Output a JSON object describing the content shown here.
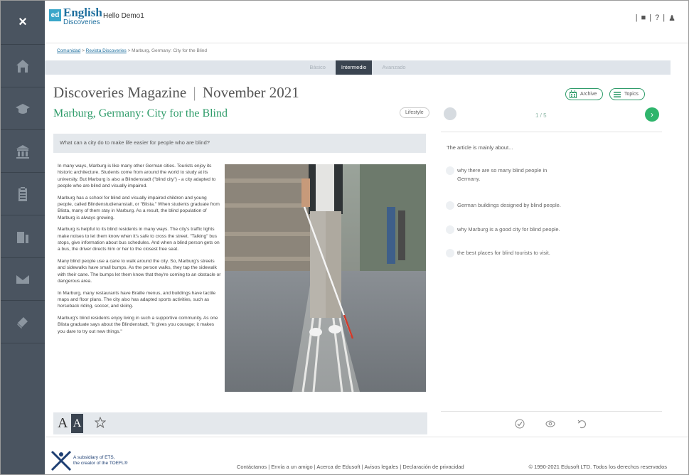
{
  "header": {
    "logo_mark": "ed",
    "logo_name": "English",
    "logo_sub": "Discoveries",
    "greeting": "Hello Demo1",
    "close_icon": "close-icon",
    "utility": [
      "|",
      "■",
      "|",
      "?",
      "|",
      "♟"
    ]
  },
  "sidebar": {
    "close_label": "×",
    "items": [
      {
        "icon": "home-icon"
      },
      {
        "icon": "graduation-cap-icon"
      },
      {
        "icon": "community-icon"
      },
      {
        "icon": "clipboard-icon"
      },
      {
        "icon": "progress-icon"
      },
      {
        "icon": "mail-icon"
      },
      {
        "icon": "book-icon"
      }
    ]
  },
  "breadcrumb": {
    "items": [
      "Comunidad",
      "Revista Discoveries",
      "Marburg, Germany: City for the Blind"
    ],
    "separator": ">"
  },
  "levels": {
    "items": [
      "Básico",
      "Intermedio",
      "Avanzado"
    ],
    "selected": "Intermedio"
  },
  "magazine": {
    "title": "Discoveries Magazine",
    "issue": "November 2021",
    "separator": "|"
  },
  "article": {
    "title": "Marburg, Germany: City for the Blind",
    "tag": "Lifestyle",
    "question_prompt": "What can a city do to make life easier for people who are blind?",
    "paragraphs": [
      "In many ways, Marburg is like many other German cities. Tourists enjoy its historic architecture. Students come from around the world to study at its university. But Marburg is also a Blindenstadt (\"blind city\") - a city adapted to people who are blind and visually impaired.",
      "Marburg has a school for blind and visually impaired children and young people, called Blindenstudienanstalt, or \"Blista.\" When students graduate from Blista, many of them stay in Marburg. As a result, the blind population of Marburg is always growing.",
      "Marburg is helpful to its blind residents in many ways. The city's traffic lights make noises to let them know when it's safe to cross the street. \"Talking\" bus stops, give information about bus schedules. And when a blind person gets on a bus, the driver directs him or her to the closest free seat.",
      "Many blind people use a cane to walk around the city. So, Marburg's streets and sidewalks have small bumps. As the person walks, they tap the sidewalk with their cane. The bumps let them know that they're coming to an obstacle or dangerous area.",
      "In Marburg, many restaurants have Braille menus, and buildings have tactile maps and floor plans. The city also has adapted sports activities, such as horseback riding, soccer, and skiing.",
      "Marburg's blind residents enjoy living in such a supportive community. As one Blista graduate says about the Blindenstadt, \"It gives you courage; it makes you dare to try out new things.\""
    ]
  },
  "toolbar": {
    "font_small": "A",
    "font_large": "A",
    "favorite_icon": "star-icon"
  },
  "buttons": {
    "archive": "Archive",
    "topics": "Topics"
  },
  "quiz": {
    "counter": "1 / 5",
    "next_label": "›",
    "question": "The article is mainly about...",
    "options": [
      "why there are so many blind people in Germany.",
      "German buildings designed by blind people.",
      "why Marburg is a good city for blind people.",
      "the best places for blind tourists to visit."
    ],
    "actions": [
      "check-icon",
      "eye-icon",
      "undo-icon"
    ]
  },
  "footer": {
    "company_line1": "A subsidiary of ETS,",
    "company_line2": "the creator of the TOEFL®",
    "links": [
      "Contáctanos",
      "Envía a un amigo",
      "Acerca de Edusoft",
      "Avisos legales",
      "Declaración de privacidad"
    ],
    "link_separator": " | ",
    "copyright": "© 1990-2021 Edusoft LTD. Todos los derechos reservados"
  },
  "colors": {
    "rail": "#4a5460",
    "accent_green": "#2f9c6a",
    "brand_blue": "#1e6f9e",
    "next_green": "#2fb56c"
  }
}
